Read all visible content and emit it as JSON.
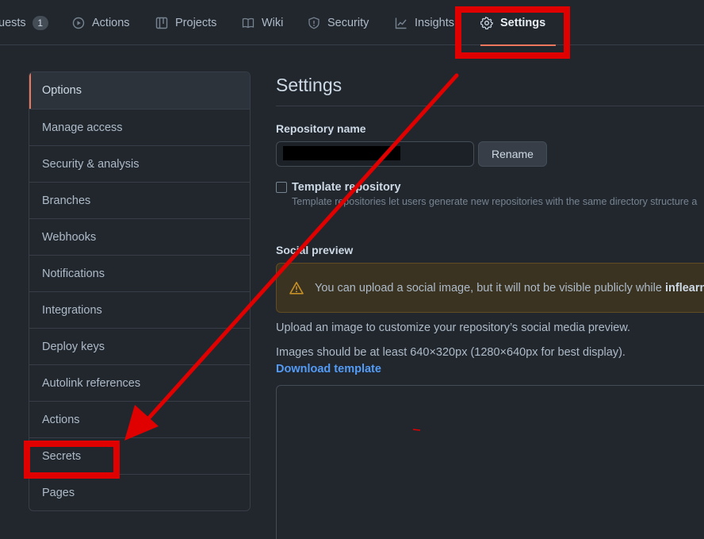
{
  "nav": {
    "tabs": [
      {
        "label": "uests",
        "count": "1",
        "icon": "pull-request-icon"
      },
      {
        "label": "Actions",
        "icon": "play-icon"
      },
      {
        "label": "Projects",
        "icon": "table-icon"
      },
      {
        "label": "Wiki",
        "icon": "book-icon"
      },
      {
        "label": "Security",
        "icon": "shield-icon"
      },
      {
        "label": "Insights",
        "icon": "graph-icon"
      },
      {
        "label": "Settings",
        "icon": "gear-icon"
      }
    ],
    "active": "Settings"
  },
  "sidebar": {
    "items": [
      {
        "label": "Options"
      },
      {
        "label": "Manage access"
      },
      {
        "label": "Security & analysis"
      },
      {
        "label": "Branches"
      },
      {
        "label": "Webhooks"
      },
      {
        "label": "Notifications"
      },
      {
        "label": "Integrations"
      },
      {
        "label": "Deploy keys"
      },
      {
        "label": "Autolink references"
      },
      {
        "label": "Actions"
      },
      {
        "label": "Secrets"
      },
      {
        "label": "Pages"
      }
    ],
    "selected": "Options"
  },
  "main": {
    "title": "Settings",
    "repo_name_label": "Repository name",
    "repo_name_value": "",
    "rename_label": "Rename",
    "template_label": "Template repository",
    "template_note": "Template repositories let users generate new repositories with the same directory structure a",
    "social_heading": "Social preview",
    "flash_text": "You can upload a social image, but it will not be visible publicly while",
    "flash_bold": "inflearn",
    "upload_text": "Upload an image to customize your repository’s social media preview.",
    "size_text": "Images should be at least 640×320px (1280×640px for best display).",
    "download_link": "Download template"
  },
  "colors": {
    "background": "#22272e",
    "accent": "#ec775c",
    "link": "#539bf5",
    "annotation": "#e00000"
  }
}
